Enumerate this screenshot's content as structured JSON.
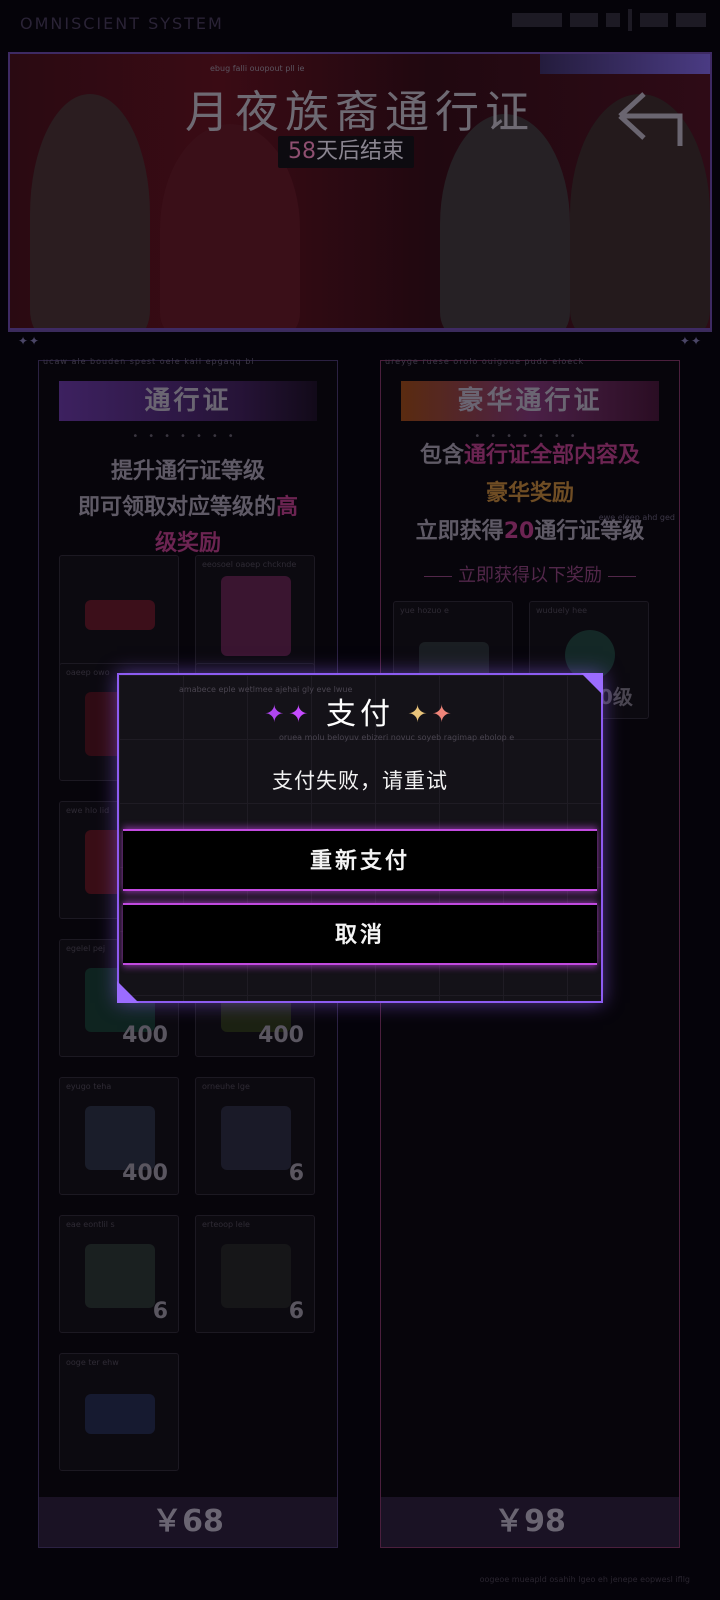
{
  "status_bar": {
    "app_name": "OMNISCIENT SYSTEM"
  },
  "banner": {
    "title": "月夜族裔通行证",
    "timer_days": "58",
    "timer_suffix": "天后结束",
    "tiny": "ebug falli ouopout pll ie"
  },
  "pass_basic": {
    "heading": "通行证",
    "tiny": "ucaw ale bouden spest oele kall epgaqq bl",
    "desc_line1": "提升通行证等级",
    "desc_line2a": "即可领取对应等级的",
    "desc_line2b": "高",
    "desc_line3": "级奖励",
    "price": "￥68",
    "items": [
      {
        "name": "",
        "qty": ""
      },
      {
        "name": "eeosoel oaoep chcknde",
        "qty": ""
      },
      {
        "name": "oaeep owo",
        "qty": ""
      },
      {
        "name": "",
        "qty": ""
      },
      {
        "name": "ewe hlo lid",
        "qty": ""
      },
      {
        "name": "",
        "qty": ""
      },
      {
        "name": "egelel pej",
        "qty": "400"
      },
      {
        "name": "",
        "qty": "400"
      },
      {
        "name": "eyugo teha",
        "qty": "400"
      },
      {
        "name": "orneuhe lge",
        "qty": "6"
      },
      {
        "name": "eae eontlil s",
        "qty": "6"
      },
      {
        "name": "erteoop lele",
        "qty": "6"
      },
      {
        "name": "ooge ter ehw",
        "qty": ""
      }
    ]
  },
  "pass_deluxe": {
    "heading": "豪华通行证",
    "tiny": "ureyge ruese orolo ouigoue pudo eloeck",
    "desc_line1a": "包含",
    "desc_line1b": "通行证全部内容及",
    "desc_line2": "豪华奖励",
    "desc_line3a": "立即获得",
    "desc_line3b": "20",
    "desc_line3c": "通行证等级",
    "sub": "立即获得以下奖励",
    "tiny2": "ewe eleep ahd ged",
    "items": [
      {
        "name": "yue hozuo e",
        "qty": ""
      },
      {
        "name": "wuduely hee",
        "qty": ""
      }
    ],
    "level_up_label": "提升20级",
    "price": "￥98"
  },
  "dialog": {
    "title": "支付",
    "message": "支付失败，请重试",
    "retry_label": "重新支付",
    "cancel_label": "取消",
    "tiny1": "amabece eple wetlmee ajehai gly eve lwue",
    "tiny2": "oruea molu beloyuv ebizeri novuc soyeb ragimap ebolop e",
    "border_color": "#8d5cf2",
    "button_glow": "#c24ae0"
  },
  "footer": {
    "tiny": "oogeoe mueapld osahih lgeo eh jenepe eopwesl ifllg"
  }
}
